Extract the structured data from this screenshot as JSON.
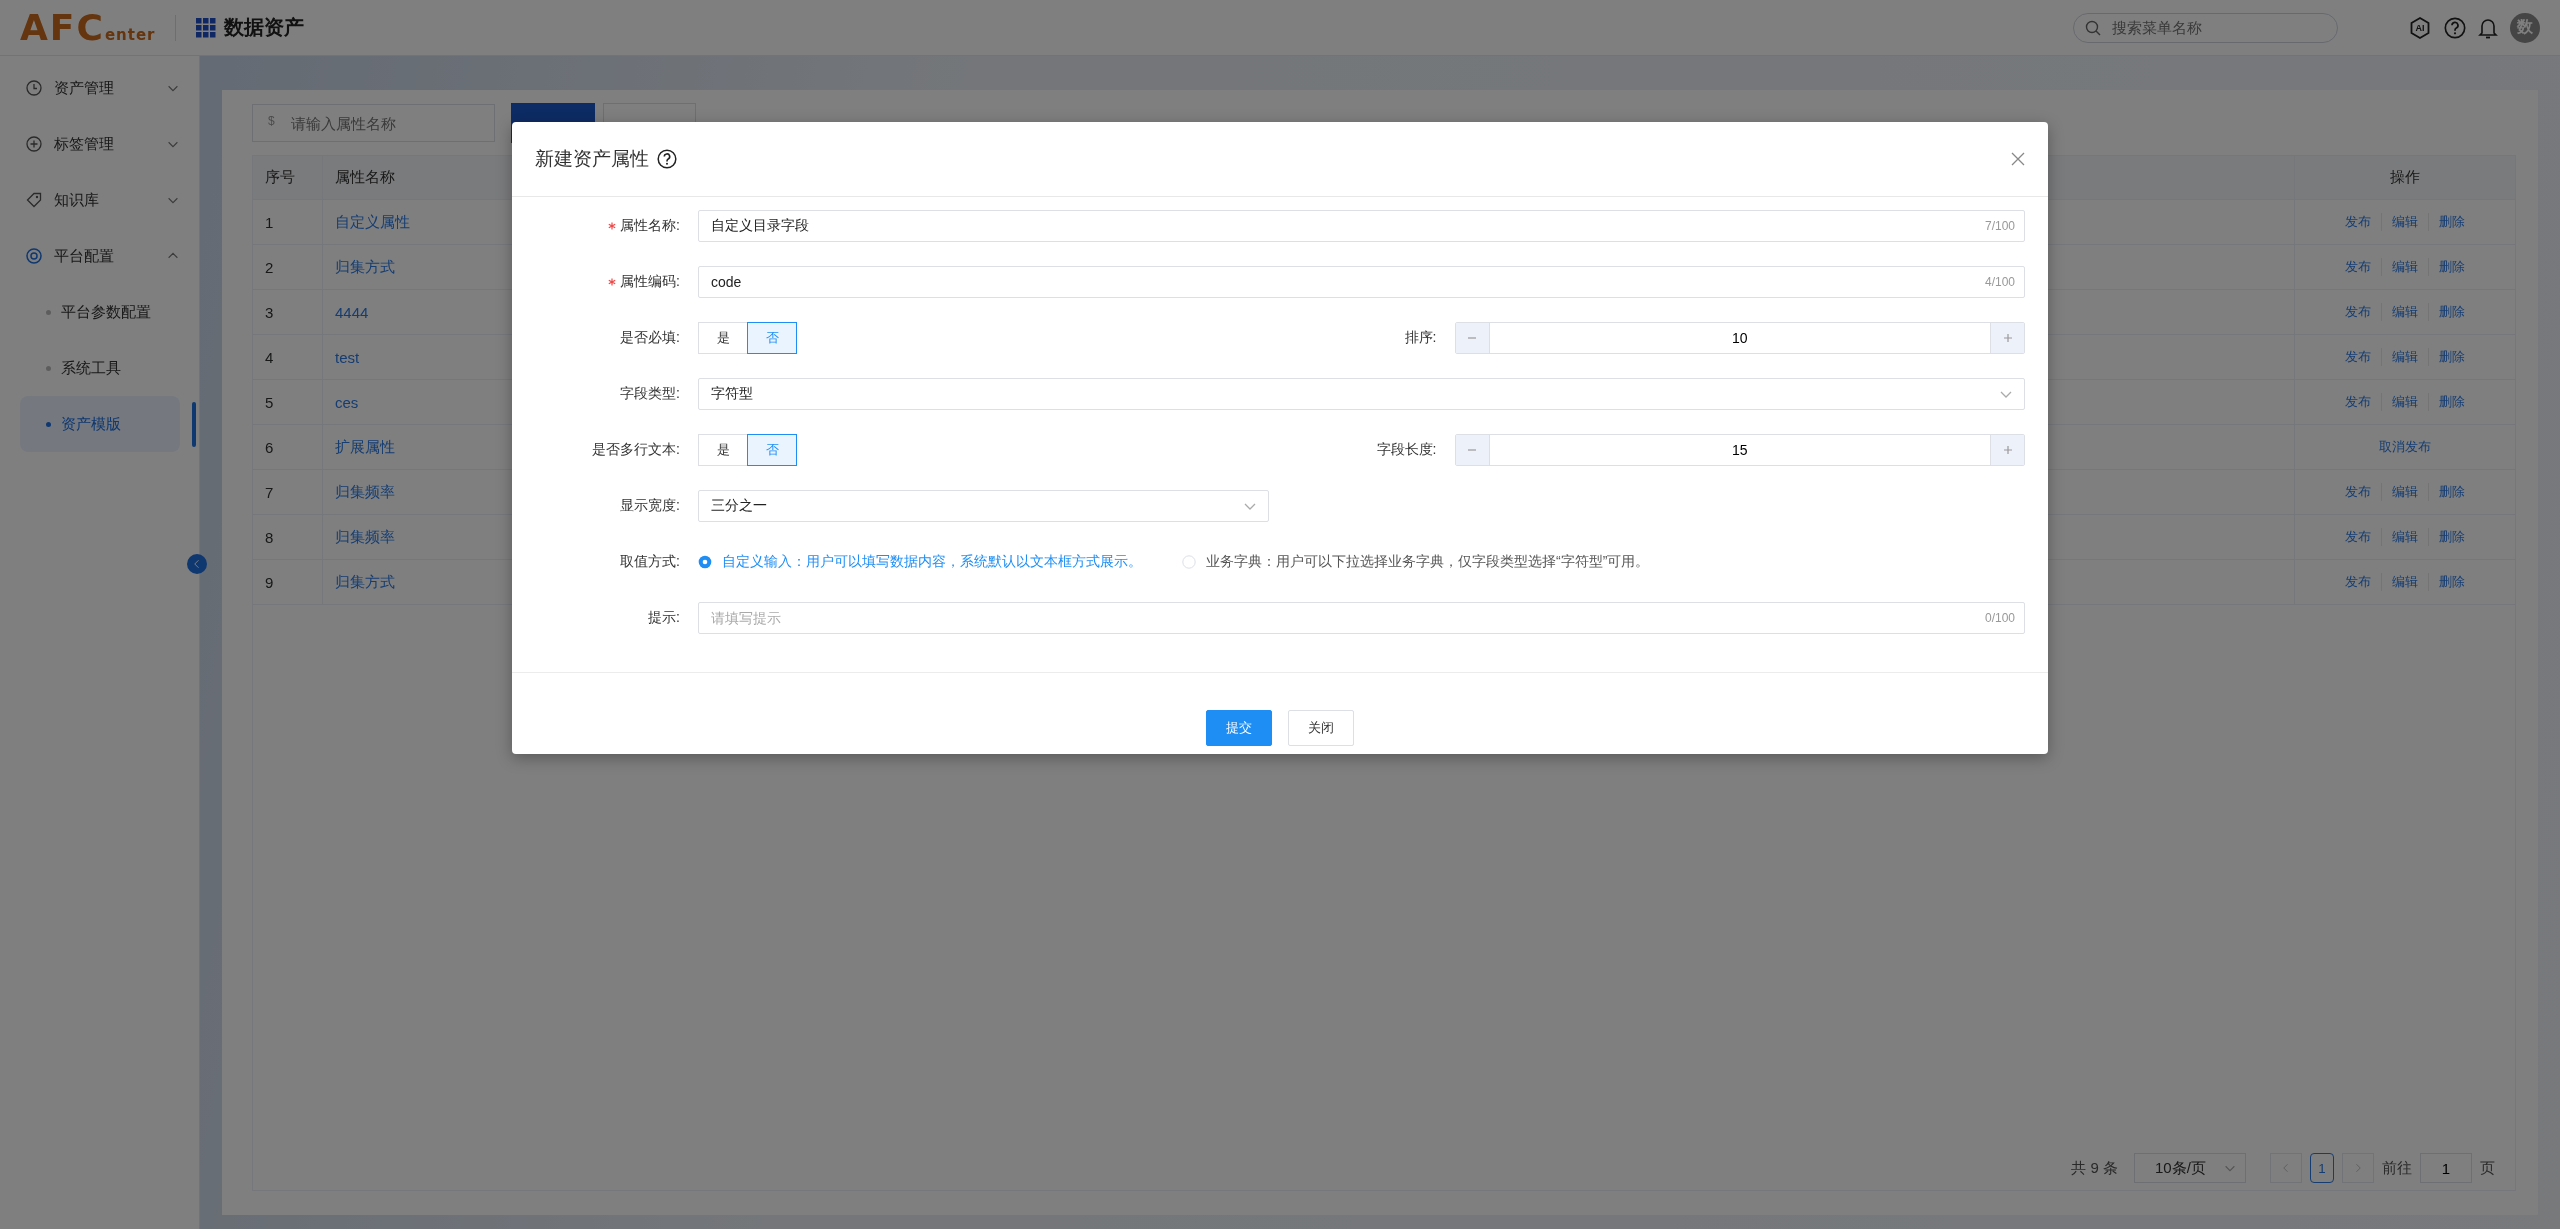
{
  "header": {
    "logo": {
      "main": "AFC",
      "sub": "enter"
    },
    "app_title": "数据资产",
    "search": {
      "placeholder": "搜索菜单名称"
    },
    "ai_label": "AI",
    "avatar": "数"
  },
  "sidebar": {
    "items": [
      {
        "label": "资产管理",
        "expanded": false
      },
      {
        "label": "标签管理",
        "expanded": false
      },
      {
        "label": "知识库",
        "expanded": false
      },
      {
        "label": "平台配置",
        "expanded": true,
        "children": [
          {
            "label": "平台参数配置",
            "selected": false
          },
          {
            "label": "系统工具",
            "selected": false
          },
          {
            "label": "资产模版",
            "selected": true
          }
        ]
      }
    ]
  },
  "toolbar": {
    "search": {
      "prefix": "$",
      "placeholder": "请输入属性名称"
    },
    "buttons": [
      {
        "kind": "primary"
      },
      {
        "kind": "reset"
      }
    ]
  },
  "table": {
    "columns": [
      {
        "label": "序号"
      },
      {
        "label": "属性名称"
      },
      {
        "label": "操作"
      }
    ],
    "rows": [
      {
        "index": "1",
        "name": "自定义属性",
        "actions": [
          "发布",
          "编辑",
          "删除"
        ]
      },
      {
        "index": "2",
        "name": "归集方式",
        "actions": [
          "发布",
          "编辑",
          "删除"
        ]
      },
      {
        "index": "3",
        "name": "4444",
        "actions": [
          "发布",
          "编辑",
          "删除"
        ]
      },
      {
        "index": "4",
        "name": "test",
        "actions": [
          "发布",
          "编辑",
          "删除"
        ]
      },
      {
        "index": "5",
        "name": "ces",
        "actions": [
          "发布",
          "编辑",
          "删除"
        ]
      },
      {
        "index": "6",
        "name": "扩展属性",
        "actions": [
          "取消发布"
        ]
      },
      {
        "index": "7",
        "name": "归集频率",
        "actions": [
          "发布",
          "编辑",
          "删除"
        ]
      },
      {
        "index": "8",
        "name": "归集频率",
        "actions": [
          "发布",
          "编辑",
          "删除"
        ]
      },
      {
        "index": "9",
        "name": "归集方式",
        "actions": [
          "发布",
          "编辑",
          "删除"
        ]
      }
    ]
  },
  "pagination": {
    "total": "共 9 条",
    "page_size": "10条/页",
    "pages": [
      {
        "label": "1",
        "selected": true
      }
    ],
    "goto_label": "前往",
    "goto_value": "1",
    "goto_suffix": "页"
  },
  "dialog": {
    "title": "新建资产属性",
    "rows": [
      {
        "kind": "input",
        "label": "属性名称:",
        "required": true,
        "value": "自定义目录字段",
        "counter": "7/100"
      },
      {
        "kind": "input",
        "label": "属性编码:",
        "required": true,
        "value": "code",
        "counter": "4/100"
      },
      {
        "kind": "pair",
        "left": {
          "label": "是否必填:",
          "options": [
            {
              "label": "是",
              "selected": false
            },
            {
              "label": "否",
              "selected": true
            }
          ]
        },
        "right": {
          "label": "排序:",
          "value": "10"
        }
      },
      {
        "kind": "select",
        "label": "字段类型:",
        "value": "字符型"
      },
      {
        "kind": "pair",
        "left": {
          "label": "是否多行文本:",
          "options": [
            {
              "label": "是",
              "selected": false
            },
            {
              "label": "否",
              "selected": true
            }
          ]
        },
        "right": {
          "label": "字段长度:",
          "value": "15"
        }
      },
      {
        "kind": "select_half",
        "label": "显示宽度:",
        "value": "三分之一"
      },
      {
        "kind": "radio",
        "label": "取值方式:",
        "options": [
          {
            "label": "自定义输入：用户可以填写数据内容，系统默认以文本框方式展示。",
            "selected": true
          },
          {
            "label": "业务字典：用户可以下拉选择业务字典，仅字段类型选择“字符型”可用。",
            "selected": false
          }
        ]
      },
      {
        "kind": "input",
        "label": "提示:",
        "required": false,
        "placeholder": "请填写提示",
        "counter": "0/100"
      }
    ],
    "buttons": [
      {
        "label": "提交",
        "kind": "primary"
      },
      {
        "label": "关闭",
        "kind": "default"
      }
    ]
  }
}
